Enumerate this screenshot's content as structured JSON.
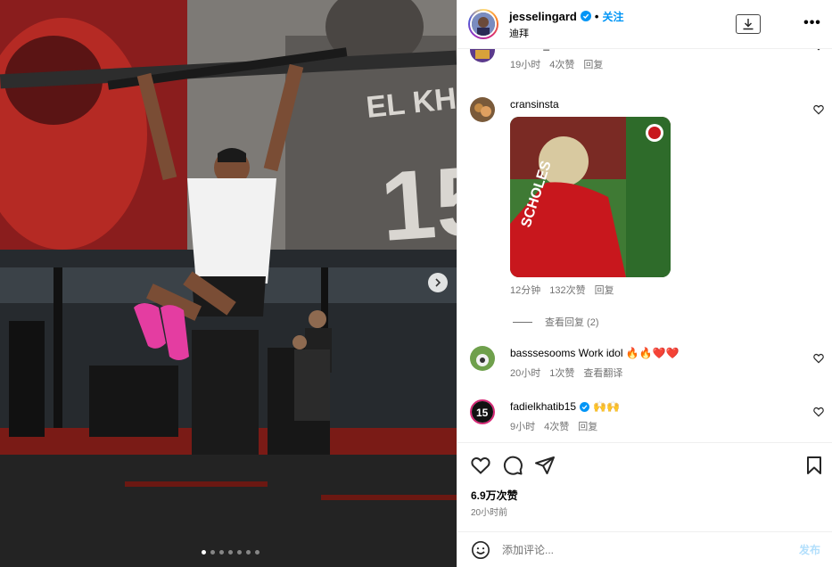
{
  "post": {
    "photo_dots": 7,
    "active_dot": 0
  },
  "header": {
    "username": "jesselingard",
    "separator": "•",
    "follow_label": "关注",
    "subtitle": "迪拜",
    "more_label": "•••"
  },
  "comments": [
    {
      "username": "emmer_nancheo",
      "text": "♥ ♥",
      "time": "19小时",
      "likes": "4次赞",
      "reply": "回复"
    },
    {
      "username": "cransinsta",
      "text": "",
      "gif_text": "SCHOLES",
      "time": "12分钟",
      "likes": "132次赞",
      "reply": "回复",
      "view_replies": "查看回复 (2)"
    },
    {
      "username": "basssesooms",
      "text": "Work idol 🔥🔥❤️❤️",
      "time": "20小时",
      "likes": "1次赞",
      "reply": "查看翻译"
    },
    {
      "username": "fadielkhatib15",
      "text": "🙌🙌",
      "time": "9小时",
      "likes": "4次赞",
      "reply": "回复"
    }
  ],
  "footer": {
    "likes": "6.9万次赞",
    "time": "20小时前",
    "comment_placeholder": "添加评论...",
    "post_label": "发布"
  },
  "colors": {
    "accent": "#0095f6",
    "meta": "#737373",
    "post_disabled": "#b2dffc",
    "verified": "#0095f6"
  }
}
